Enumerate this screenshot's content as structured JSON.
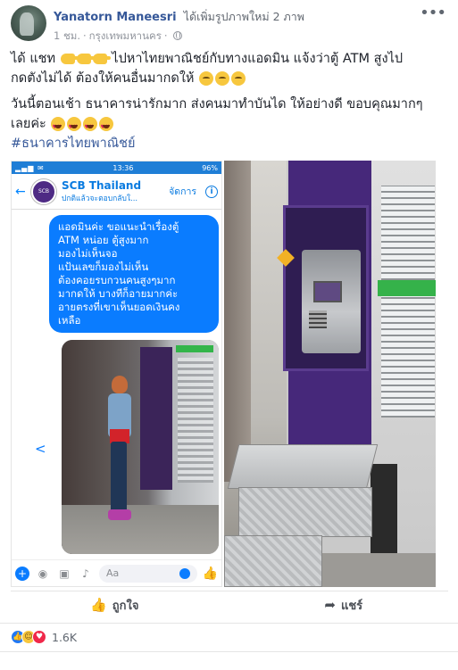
{
  "post": {
    "author": "Yanatorn Maneesri",
    "action": "ได้เพิ่มรูปภาพใหม่ 2 ภาพ",
    "time": "1 ชม.",
    "location": "กรุงเทพมหานคร",
    "more_icon": "more-icon",
    "text_line1_a": "ได้ แชท",
    "text_line1_b": "ไปหาไทยพาณิชย์กับทางแอดมิน แจ้งว่าตู้ ATM สูงไป",
    "text_line2": "กดตังไม่ได้ ต้องให้คนอื่นมากดให้",
    "text_line3": "วันนี้ตอนเช้า ธนาคารน่ารักมาก ส่งคนมาทำบันได ให้อย่างดี ขอบคุณมากๆ",
    "text_line4": "เลยค่ะ",
    "hashtag": "#ธนาคารไทยพาณิชย์"
  },
  "screenshot": {
    "status_time": "13:36",
    "status_battery": "96%",
    "chat_name": "SCB Thailand",
    "chat_sub": "ปกติแล้วจะตอบกลับใ...",
    "logo_text": "SCB",
    "manage_label": "จัดการ",
    "bubble_lines": [
      "แอดมินค่ะ  ขอแนะนำเรื่องตู้",
      "ATM หน่อย  ตู้สูงมาก",
      "มองไม่เห็นจอ",
      "แป้นเลขก็มองไม่เห็น",
      "ต้องคอยรบกวนคนสูงๆมาก",
      "มากดให้    บางทีก็อายมากค่ะ",
      "อายตรงที่เขาเห็นยอดเงินคง",
      "เหลือ"
    ],
    "input_placeholder": "Aa"
  },
  "actions": {
    "like_label": "ถูกใจ",
    "share_label": "แชร์"
  },
  "reactions": {
    "count": "1.6K",
    "types": [
      "like",
      "haha",
      "love"
    ]
  }
}
